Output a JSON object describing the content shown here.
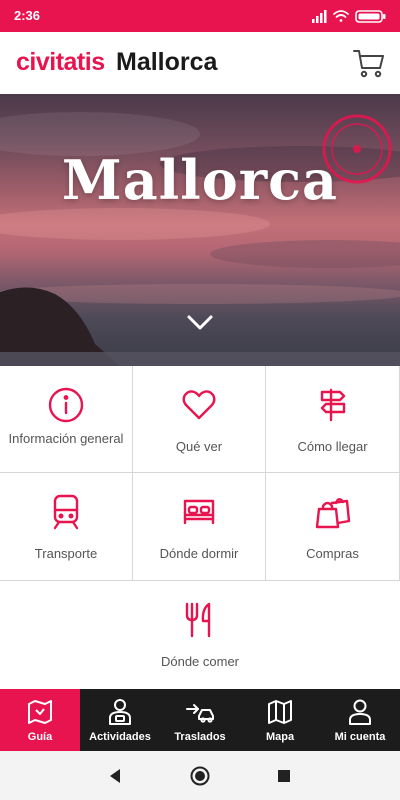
{
  "status_bar": {
    "time": "2:36",
    "icons": [
      "signal-icon",
      "wifi-icon",
      "battery-icon"
    ]
  },
  "header": {
    "brand": "civitatis",
    "city": "Mallorca",
    "cart_icon": "cart-icon"
  },
  "hero": {
    "title": "Mallorca",
    "badge_icon": "top-destination-stamp",
    "chevron_icon": "chevron-down-icon"
  },
  "tiles": [
    {
      "label": "Información general",
      "icon": "info-icon"
    },
    {
      "label": "Qué ver",
      "icon": "heart-icon"
    },
    {
      "label": "Cómo llegar",
      "icon": "signpost-icon"
    },
    {
      "label": "Transporte",
      "icon": "train-icon"
    },
    {
      "label": "Dónde dormir",
      "icon": "bed-icon"
    },
    {
      "label": "Compras",
      "icon": "shopping-bags-icon"
    },
    {
      "label": "Dónde comer",
      "icon": "fork-knife-icon"
    }
  ],
  "bottom_nav": [
    {
      "label": "Guía",
      "icon": "map-book-icon",
      "active": true
    },
    {
      "label": "Actividades",
      "icon": "guide-person-icon",
      "active": false
    },
    {
      "label": "Traslados",
      "icon": "car-arrow-icon",
      "active": false
    },
    {
      "label": "Mapa",
      "icon": "map-icon",
      "active": false
    },
    {
      "label": "Mi cuenta",
      "icon": "user-icon",
      "active": false
    }
  ],
  "system_nav": [
    "back-icon",
    "home-icon",
    "recents-icon"
  ],
  "colors": {
    "accent": "#e8144f",
    "nav_bg": "#1c1c1c",
    "tile_text": "#555555",
    "divider": "#d7d7d7"
  }
}
